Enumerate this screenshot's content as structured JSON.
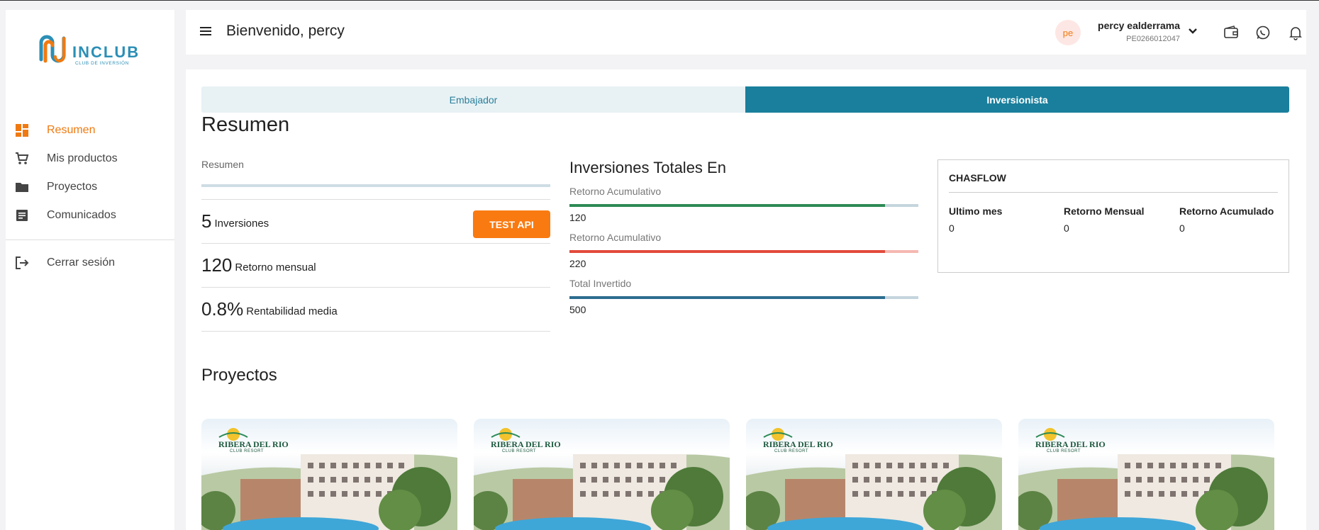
{
  "app": {
    "logo_word": "INCLUB",
    "logo_sub": "CLUB DE INVERSIÓN"
  },
  "sidebar": {
    "items": [
      {
        "label": "Resumen",
        "icon": "dashboard-icon",
        "active": true
      },
      {
        "label": "Mis productos",
        "icon": "cart-icon"
      },
      {
        "label": "Proyectos",
        "icon": "folder-icon"
      },
      {
        "label": "Comunicados",
        "icon": "document-icon"
      }
    ],
    "logout_label": "Cerrar sesión"
  },
  "header": {
    "welcome": "Bienvenido, percy",
    "user": {
      "initials": "pe",
      "name": "percy ealderrama",
      "code": "PE0266012047"
    }
  },
  "tabs": [
    {
      "label": "Embajador",
      "active": false
    },
    {
      "label": "Inversionista",
      "active": true
    }
  ],
  "resumen": {
    "title": "Resumen",
    "section_label": "Resumen",
    "stats": [
      {
        "value": "5",
        "label": "Inversiones"
      },
      {
        "value": "120",
        "label": "Retorno mensual"
      },
      {
        "value": "0.8%",
        "label": "Rentabilidad media"
      }
    ],
    "test_api_label": "TEST API"
  },
  "inversiones": {
    "title": "Inversiones Totales En",
    "metrics": [
      {
        "label": "Retorno Acumulativo",
        "value": "120",
        "fill": 0.905,
        "color": "#2e8a55",
        "track": "#c5d5dd"
      },
      {
        "label": "Retorno Acumulativo",
        "value": "220",
        "fill": 0.905,
        "color": "#e24a3c",
        "track": "#f5b8b2"
      },
      {
        "label": "Total Invertido",
        "value": "500",
        "fill": 0.905,
        "color": "#2c6d8f",
        "track": "#c5d5dd"
      }
    ]
  },
  "cashflow": {
    "title": "CHASFLOW",
    "columns": [
      {
        "label": "Ultimo mes",
        "value": "0"
      },
      {
        "label": "Retorno Mensual",
        "value": "0"
      },
      {
        "label": "Retorno Acumulado",
        "value": "0"
      }
    ]
  },
  "proyectos": {
    "title": "Proyectos",
    "cards": [
      {
        "brand": "RIBERA DEL RIO",
        "sub": "CLUB RESORT"
      },
      {
        "brand": "RIBERA DEL RIO",
        "sub": "CLUB RESORT"
      },
      {
        "brand": "RIBERA DEL RIO",
        "sub": "CLUB RESORT"
      },
      {
        "brand": "RIBERA DEL RIO",
        "sub": "CLUB RESORT"
      }
    ]
  },
  "colors": {
    "accent": "#f07a11",
    "primary": "#1a7f9c"
  }
}
